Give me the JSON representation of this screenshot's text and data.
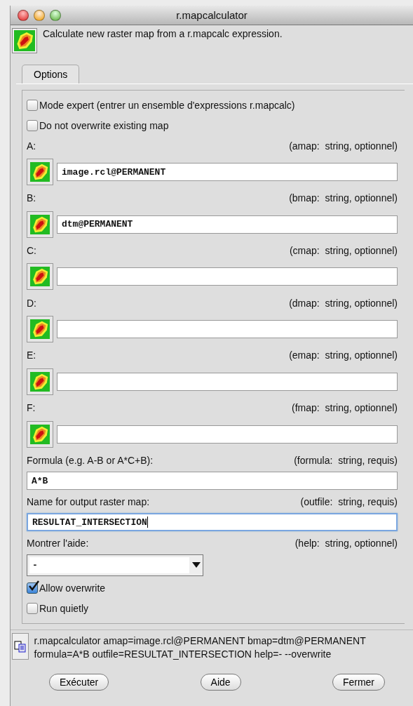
{
  "window": {
    "title": "r.mapcalculator"
  },
  "description": "Calculate new raster map from a r.mapcalc expression.",
  "tabs": [
    {
      "label": "Options",
      "selected": true
    }
  ],
  "options": [
    {
      "kind": "checkbox",
      "label": "Mode expert (entrer un ensemble d'expressions r.mapcalc)",
      "checked": false
    },
    {
      "kind": "checkbox",
      "label": "Do not overwrite existing map",
      "checked": false
    },
    {
      "kind": "map",
      "label": "A:",
      "hint": "(amap:  string, optionnel)",
      "value": "image.rcl@PERMANENT"
    },
    {
      "kind": "map",
      "label": "B:",
      "hint": "(bmap:  string, optionnel)",
      "value": "dtm@PERMANENT"
    },
    {
      "kind": "map",
      "label": "C:",
      "hint": "(cmap:  string, optionnel)"
    },
    {
      "kind": "map",
      "label": "D:",
      "hint": "(dmap:  string, optionnel)"
    },
    {
      "kind": "map",
      "label": "E:",
      "hint": "(emap:  string, optionnel)"
    },
    {
      "kind": "map",
      "label": "F:",
      "hint": "(fmap:  string, optionnel)"
    },
    {
      "kind": "text",
      "label": "Formula (e.g. A-B or A*C+B):",
      "hint": "(formula:  string, requis)",
      "value": "A*B",
      "focused": false
    },
    {
      "kind": "text",
      "label": "Name for output raster map:",
      "hint": "(outfile:  string, requis)",
      "value": "RESULTAT_INTERSECTION",
      "focused": true
    },
    {
      "kind": "select",
      "label": "Montrer l'aide:",
      "hint": "(help:  string, optionnel)",
      "value": "-"
    },
    {
      "kind": "checkbox",
      "label": "Allow overwrite",
      "checked": true
    },
    {
      "kind": "checkbox",
      "label": "Run quietly",
      "checked": false
    }
  ],
  "command": "r.mapcalculator amap=image.rcl@PERMANENT bmap=dtm@PERMANENT formula=A*B outfile=RESULTAT_INTERSECTION help=- --overwrite",
  "buttons": [
    "Exécuter",
    "Aide",
    "Fermer"
  ]
}
